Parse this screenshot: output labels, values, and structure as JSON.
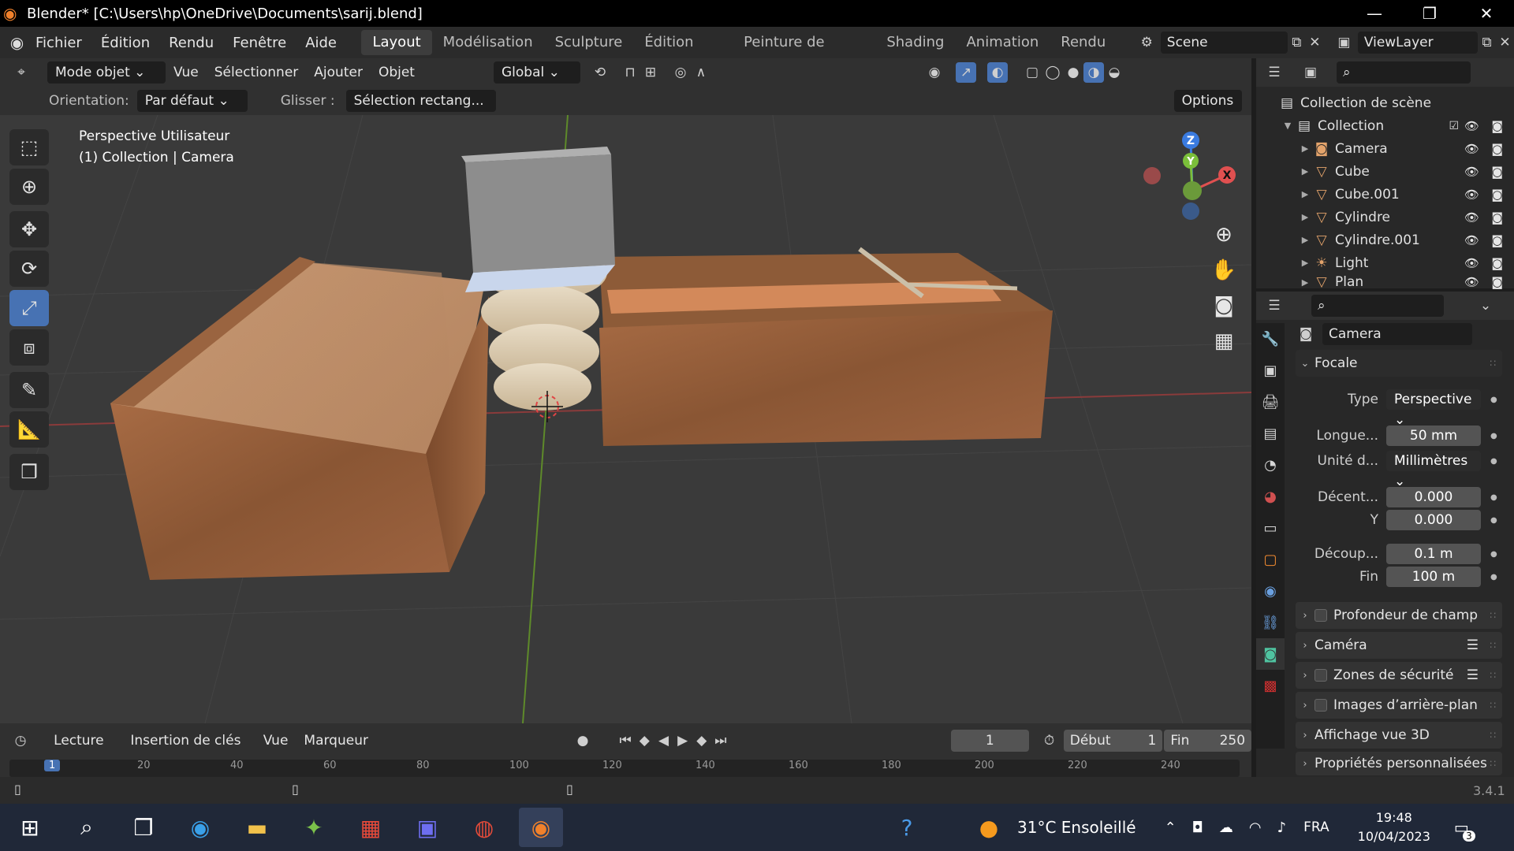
{
  "window": {
    "title": "Blender* [C:\\Users\\hp\\OneDrive\\Documents\\sarij.blend]",
    "minimize": "—",
    "maximize": "❐",
    "close": "✕"
  },
  "menubar": {
    "menus": [
      "Fichier",
      "Édition",
      "Rendu",
      "Fenêtre",
      "Aide"
    ],
    "workspaces": [
      "Layout",
      "Modélisation",
      "Sculpture",
      "Édition d’UV",
      "Peinture de texture",
      "Shading",
      "Animation",
      "Rendu"
    ],
    "active_workspace": "Layout",
    "scene": "Scene",
    "view_layer": "ViewLayer"
  },
  "header": {
    "mode": "Mode objet",
    "menus": [
      "Vue",
      "Sélectionner",
      "Ajouter",
      "Objet"
    ],
    "transform": "Global",
    "orientation_label": "Orientation:",
    "orientation_value": "Par défaut",
    "drag_label": "Glisser :",
    "drag_value": "Sélection rectang...",
    "options": "Options"
  },
  "viewport": {
    "line1": "Perspective Utilisateur",
    "line2": "(1) Collection | Camera",
    "gizmo": {
      "z": "Z",
      "y": "Y",
      "x": "X"
    }
  },
  "outliner": {
    "root": "Collection de scène",
    "collection": "Collection",
    "items": [
      "Camera",
      "Cube",
      "Cube.001",
      "Cylindre",
      "Cylindre.001",
      "Light",
      "Plan"
    ]
  },
  "properties": {
    "object_name": "Camera",
    "section": "Focale",
    "fields": {
      "type_label": "Type",
      "type_value": "Perspective",
      "focal_label": "Longue...",
      "focal_value": "50 mm",
      "unit_label": "Unité d...",
      "unit_value": "Millimètres",
      "shiftx_label": "Décent...",
      "shiftx_value": "0.000",
      "shifty_label": "Y",
      "shifty_value": "0.000",
      "clip_label": "Découp...",
      "clip_value": "0.1 m",
      "end_label": "Fin",
      "end_value": "100 m"
    },
    "panels": [
      "Profondeur de champ",
      "Caméra",
      "Zones de sécurité",
      "Images d’arrière-plan",
      "Affichage vue 3D",
      "Propriétés personnalisées"
    ]
  },
  "timeline": {
    "menus": [
      "Lecture",
      "Insertion de clés",
      "Vue",
      "Marqueur"
    ],
    "current_frame": "1",
    "start_label": "Début",
    "start_value": "1",
    "end_label": "Fin",
    "end_value": "250",
    "ticks": [
      "1",
      "20",
      "40",
      "60",
      "80",
      "100",
      "120",
      "140",
      "160",
      "180",
      "200",
      "220",
      "240"
    ]
  },
  "statusbar": {
    "version": "3.4.1"
  },
  "taskbar": {
    "weather": "31°C  Ensoleillé",
    "lang": "FRA",
    "time": "19:48",
    "date": "10/04/2023",
    "notif": "3"
  },
  "colors": {
    "accent": "#4772b3",
    "viewport_bg": "#3a3a3a",
    "wood": "#9a5f3a"
  }
}
